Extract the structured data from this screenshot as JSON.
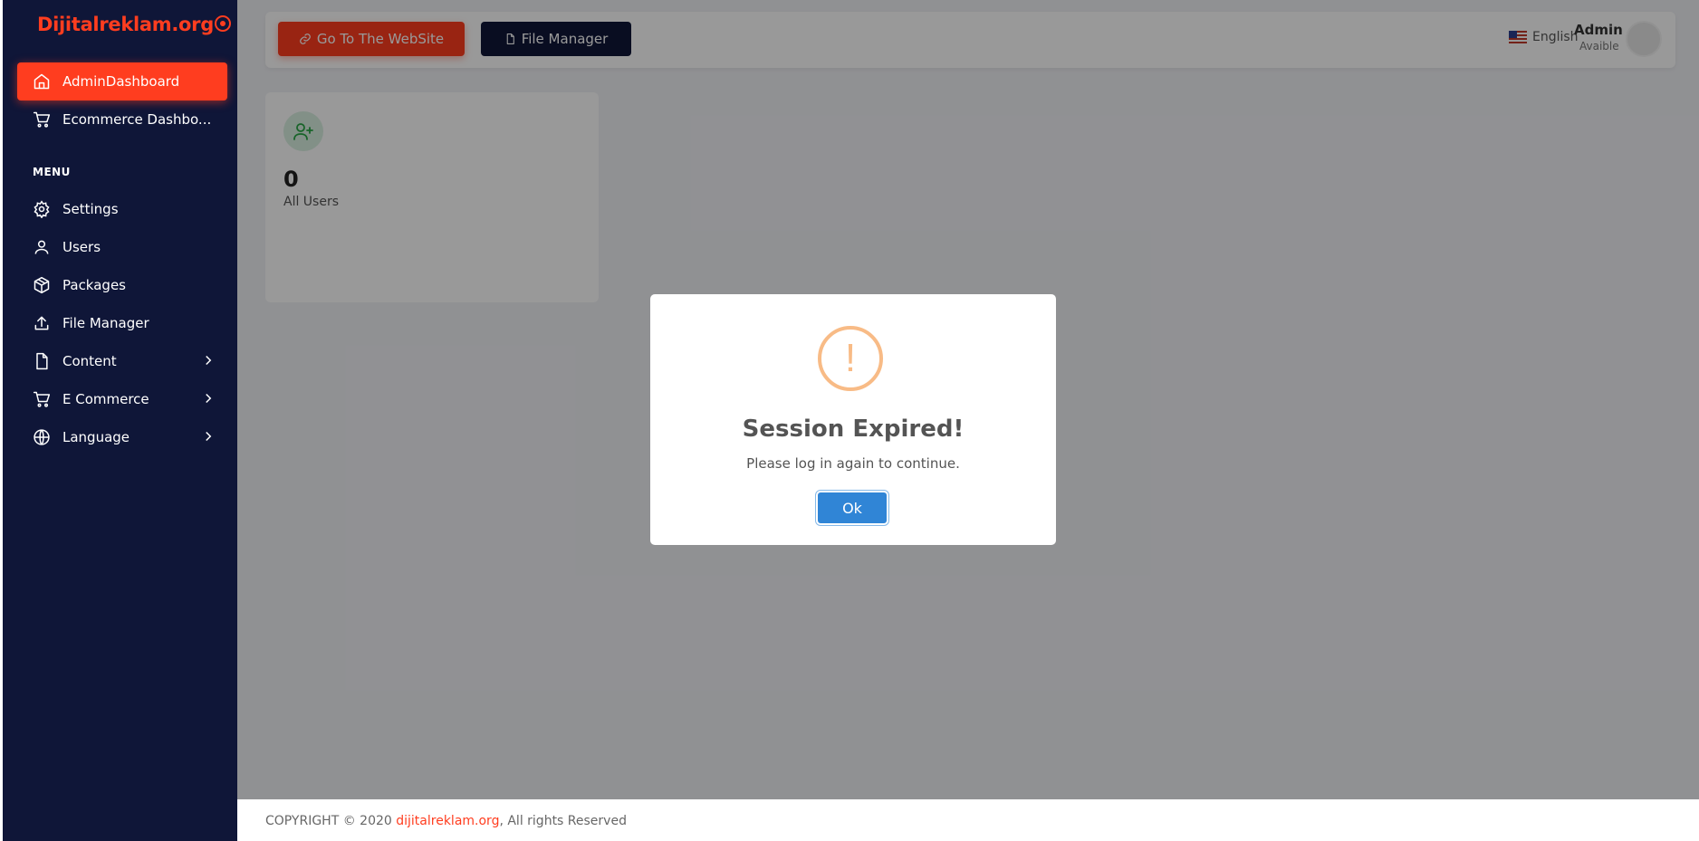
{
  "brand": {
    "name": "Dijitalreklam.org",
    "color": "#ff3d1f"
  },
  "sidebar": {
    "items": [
      {
        "label": "AdminDashboard",
        "icon": "home-icon",
        "active": true
      },
      {
        "label": "Ecommerce Dashbo...",
        "icon": "cart-icon"
      }
    ],
    "menu_title": "MENU",
    "menu": [
      {
        "label": "Settings",
        "icon": "gear-icon"
      },
      {
        "label": "Users",
        "icon": "user-icon"
      },
      {
        "label": "Packages",
        "icon": "package-icon"
      },
      {
        "label": "File Manager",
        "icon": "upload-icon"
      },
      {
        "label": "Content",
        "icon": "file-icon",
        "has_children": true
      },
      {
        "label": "E Commerce",
        "icon": "cart-icon",
        "has_children": true
      },
      {
        "label": "Language",
        "icon": "globe-icon",
        "has_children": true
      }
    ]
  },
  "topbar": {
    "website_button": "Go To The WebSite",
    "file_manager_button": "File Manager",
    "language": "English",
    "user_name": "Admin",
    "user_status": "Avaible"
  },
  "stats": {
    "count": "0",
    "label": "All Users"
  },
  "modal": {
    "title": "Session Expired!",
    "text": "Please log in again to continue.",
    "ok": "Ok",
    "icon": "warning-icon"
  },
  "footer": {
    "prefix": "COPYRIGHT © 2020 ",
    "link": "dijitalreklam.org",
    "suffix": ", All rights Reserved"
  },
  "colors": {
    "sidebar_bg": "#0f1638",
    "accent": "#ff3d1f",
    "modal_button": "#3085d6",
    "warning": "#f8bb86"
  }
}
